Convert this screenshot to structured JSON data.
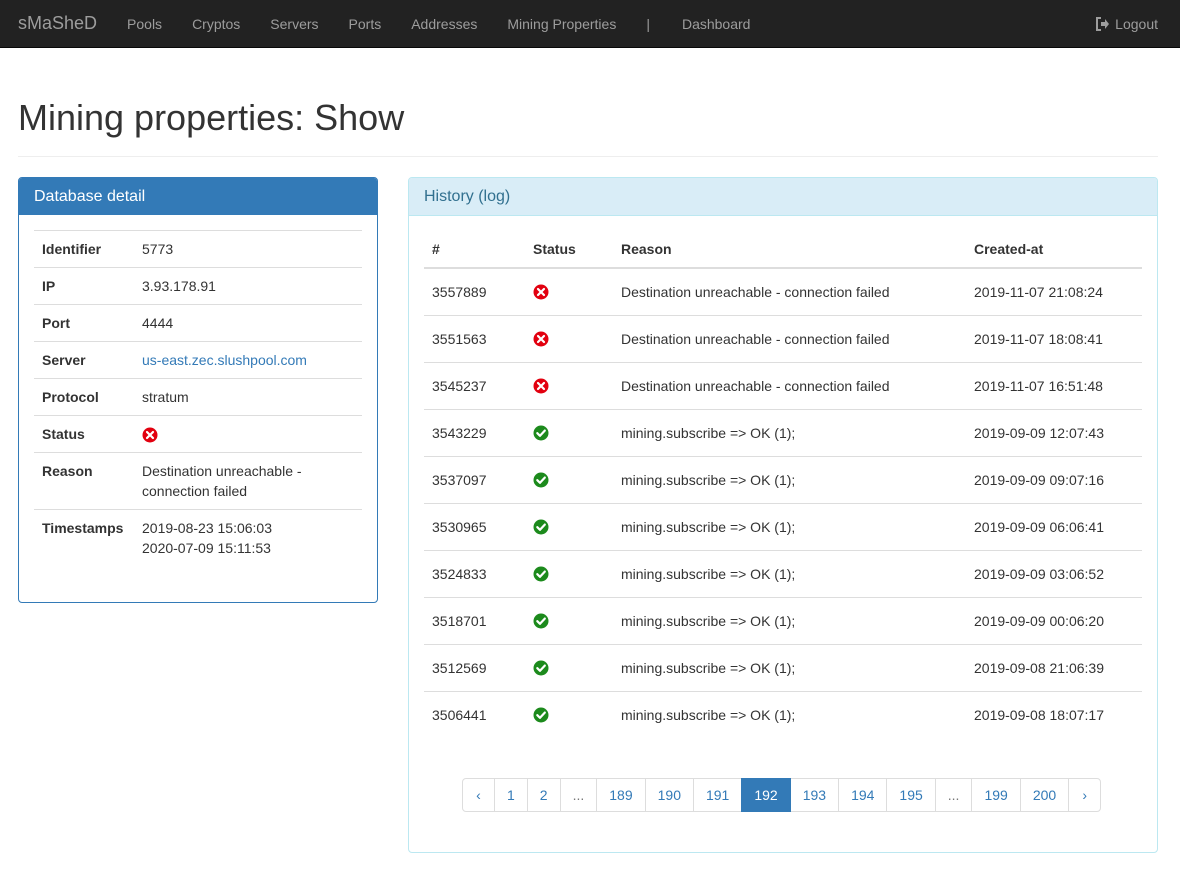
{
  "navbar": {
    "brand": "sMaSheD",
    "items": [
      "Pools",
      "Cryptos",
      "Servers",
      "Ports",
      "Addresses",
      "Mining Properties"
    ],
    "separator": "|",
    "dashboard": "Dashboard",
    "logout": "Logout"
  },
  "page": {
    "title": "Mining properties: Show"
  },
  "detail": {
    "heading": "Database detail",
    "rows": [
      {
        "key": "Identifier",
        "value": "5773"
      },
      {
        "key": "IP",
        "value": "3.93.178.91"
      },
      {
        "key": "Port",
        "value": "4444"
      },
      {
        "key": "Server",
        "value": "us-east.zec.slushpool.com"
      },
      {
        "key": "Protocol",
        "value": "stratum"
      },
      {
        "key": "Status",
        "value": "error"
      },
      {
        "key": "Reason",
        "value": "Destination unreachable - connection failed"
      },
      {
        "key": "Timestamps",
        "value": "2019-08-23 15:06:03",
        "value2": "2020-07-09 15:11:53"
      }
    ]
  },
  "history": {
    "heading": "History (log)",
    "columns": [
      "#",
      "Status",
      "Reason",
      "Created-at"
    ],
    "rows": [
      {
        "id": "3557889",
        "status": "error",
        "reason": "Destination unreachable - connection failed",
        "created": "2019-11-07 21:08:24"
      },
      {
        "id": "3551563",
        "status": "error",
        "reason": "Destination unreachable - connection failed",
        "created": "2019-11-07 18:08:41"
      },
      {
        "id": "3545237",
        "status": "error",
        "reason": "Destination unreachable - connection failed",
        "created": "2019-11-07 16:51:48"
      },
      {
        "id": "3543229",
        "status": "ok",
        "reason": "mining.subscribe => OK (1);",
        "created": "2019-09-09 12:07:43"
      },
      {
        "id": "3537097",
        "status": "ok",
        "reason": "mining.subscribe => OK (1);",
        "created": "2019-09-09 09:07:16"
      },
      {
        "id": "3530965",
        "status": "ok",
        "reason": "mining.subscribe => OK (1);",
        "created": "2019-09-09 06:06:41"
      },
      {
        "id": "3524833",
        "status": "ok",
        "reason": "mining.subscribe => OK (1);",
        "created": "2019-09-09 03:06:52"
      },
      {
        "id": "3518701",
        "status": "ok",
        "reason": "mining.subscribe => OK (1);",
        "created": "2019-09-09 00:06:20"
      },
      {
        "id": "3512569",
        "status": "ok",
        "reason": "mining.subscribe => OK (1);",
        "created": "2019-09-08 21:06:39"
      },
      {
        "id": "3506441",
        "status": "ok",
        "reason": "mining.subscribe => OK (1);",
        "created": "2019-09-08 18:07:17"
      }
    ]
  },
  "pagination": {
    "pages": [
      "‹",
      "1",
      "2",
      "...",
      "189",
      "190",
      "191",
      "192",
      "193",
      "194",
      "195",
      "...",
      "199",
      "200",
      "›"
    ],
    "active": "192"
  },
  "colors": {
    "primary": "#337ab7",
    "error": "#e2000f",
    "ok": "#1c8a1c",
    "info_bg": "#d9edf7"
  }
}
